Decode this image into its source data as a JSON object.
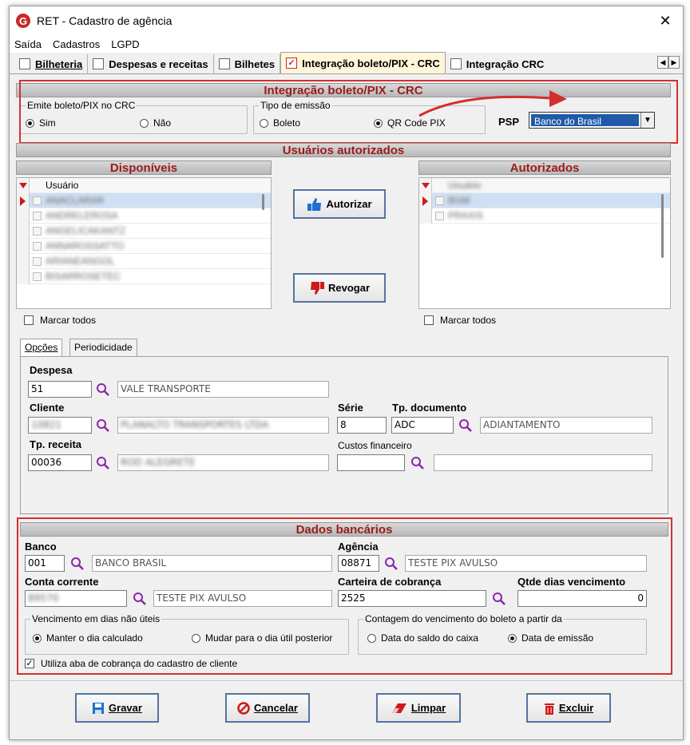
{
  "window": {
    "title": "RET - Cadastro de agência",
    "logo_letter": "G",
    "close": "✕"
  },
  "menu": [
    "Saída",
    "Cadastros",
    "LGPD"
  ],
  "tabs": [
    {
      "label": "Bilheteria",
      "icon": "document-icon"
    },
    {
      "label": "Despesas e receitas",
      "icon": "edit-document-icon"
    },
    {
      "label": "Bilhetes",
      "icon": "calendar-icon"
    },
    {
      "label": "Integração boleto/PIX - CRC",
      "icon": "checkbox-icon",
      "active": true
    },
    {
      "label": "Integração CRC",
      "icon": "edit-document-icon"
    }
  ],
  "tab_scroll": {
    "left": "◀",
    "right": "▶"
  },
  "integracao": {
    "header": "Integração boleto/PIX - CRC",
    "emite_title": "Emite boleto/PIX no CRC",
    "emite_options": [
      "Sim",
      "Não"
    ],
    "emite_selected": "Sim",
    "tipo_title": "Tipo de emissão",
    "tipo_options": [
      "Boleto",
      "QR Code PIX"
    ],
    "tipo_selected": "QR Code PIX",
    "psp_label": "PSP",
    "psp_value": "Banco do Brasil",
    "arrow_color": "#d32f2f"
  },
  "usuarios": {
    "header": "Usuários autorizados",
    "disponiveis": {
      "header": "Disponíveis",
      "column": "Usuário",
      "rows": [
        "ANACLARAR",
        "ANDRELEROSA",
        "ANGELICAKANTZ",
        "ANNAROSSATTO",
        "ARIANEANGOL",
        "BISARROSETEC"
      ],
      "marcar_todos": "Marcar todos"
    },
    "autorizados": {
      "header": "Autorizados",
      "column": "Usuário",
      "rows": [
        "BGM",
        "PRAXIS"
      ],
      "marcar_todos": "Marcar todos"
    },
    "autorizar_label": "Autorizar",
    "revogar_label": "Revogar"
  },
  "subtabs": [
    "Opções",
    "Periodicidade"
  ],
  "opcoes": {
    "despesa_label": "Despesa",
    "despesa_code": "51",
    "despesa_desc": "VALE TRANSPORTE",
    "cliente_label": "Cliente",
    "cliente_code": "10821",
    "cliente_desc": "PLANALTO TRANSPORTES LTDA",
    "serie_label": "Série",
    "serie_value": "8",
    "tpdoc_label": "Tp. documento",
    "tpdoc_code": "ADC",
    "tpdoc_desc": "ADIANTAMENTO",
    "tpreceita_label": "Tp. receita",
    "tpreceita_code": "00036",
    "tpreceita_desc": "ROD ALEGRETE",
    "custos_label": "Custos financeiro",
    "custos_code": "",
    "custos_desc": ""
  },
  "bancarios": {
    "header": "Dados bancários",
    "banco_label": "Banco",
    "banco_code": "001",
    "banco_desc": "BANCO BRASIL",
    "agencia_label": "Agência",
    "agencia_code": "08871",
    "agencia_desc": "TESTE PIX AVULSO",
    "conta_label": "Conta corrente",
    "conta_code": "89570",
    "conta_desc": "TESTE PIX AVULSO",
    "carteira_label": "Carteira de cobrança",
    "carteira_value": "2525",
    "qtde_label": "Qtde dias vencimento",
    "qtde_value": "0",
    "venc_title": "Vencimento em dias não úteis",
    "venc_options": [
      "Manter o dia calculado",
      "Mudar para o dia útil posterior"
    ],
    "venc_selected": "Manter o dia calculado",
    "contagem_title": "Contagem do vencimento do boleto a partir da",
    "contagem_options": [
      "Data do saldo do caixa",
      "Data de emissão"
    ],
    "contagem_selected": "Data de emissão",
    "utiliza_label": "Utiliza aba de cobrança do cadastro de cliente",
    "utiliza_checked": true
  },
  "footer": {
    "gravar": "Gravar",
    "cancelar": "Cancelar",
    "limpar": "Limpar",
    "excluir": "Excluir"
  },
  "colors": {
    "highlight": "#d32f2f",
    "section_text": "#9b1b1b",
    "selection": "#1e5aa8"
  }
}
